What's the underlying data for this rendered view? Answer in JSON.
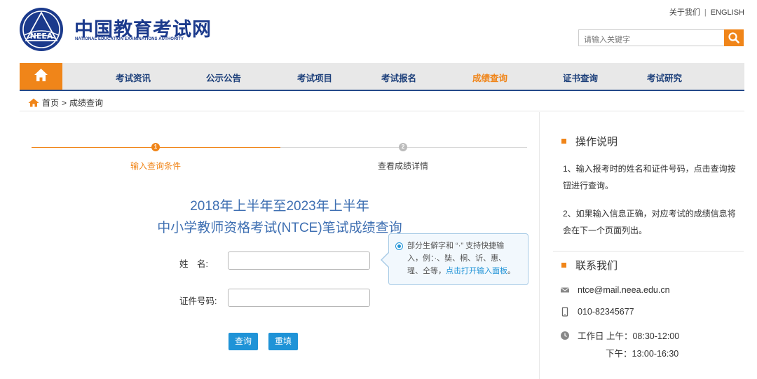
{
  "header": {
    "logo_cn": "中国教育考试网",
    "logo_en": "NATIONAL EDUCATION EXAMINATIONS AUTHORITY",
    "logo_emblem_text": "NEEA",
    "top_links": [
      "关于我们",
      "ENGLISH"
    ],
    "search_placeholder": "请输入关键字",
    "search_icon": "search-icon"
  },
  "nav": {
    "home_icon": "home-icon",
    "items": [
      "考试资讯",
      "公示公告",
      "考试项目",
      "考试报名",
      "成绩查询",
      "证书查询",
      "考试研究"
    ],
    "active": "成绩查询"
  },
  "breadcrumb": {
    "home": "首页",
    "separator": ">",
    "current": "成绩查询"
  },
  "steps": [
    {
      "number": "1",
      "label": "输入查询条件"
    },
    {
      "number": "2",
      "label": "查看成绩详情"
    }
  ],
  "query": {
    "title_line1": "2018年上半年至2023年上半年",
    "title_line2": "中小学教师资格考试(NTCE)笔试成绩查询",
    "name_label": "姓　名:",
    "id_label": "证件号码:",
    "name_value": "",
    "id_value": "",
    "submit": "查询",
    "reset": "重填"
  },
  "tooltip": {
    "line1": "部分生僻字和 “·” 支持快捷输",
    "line2": "入，例：·、奘、桐、䜣、惠、",
    "line3_prefix": "瑆、仝等，",
    "line3_link": "点击打开输入面板",
    "line3_suffix": "。"
  },
  "sidebar": {
    "instructions_title": "操作说明",
    "instructions": [
      "1、输入报考时的姓名和证件号码，点击查询按钮进行查询。",
      "2、如果输入信息正确，对应考试的成绩信息将会在下一个页面列出。"
    ],
    "contact_title": "联系我们",
    "email": "ntce@mail.neea.edu.cn",
    "phone": "010-82345677",
    "hours_line1": "工作日 上午：08:30-12:00",
    "hours_line2": "下午：13:00-16:30"
  },
  "colors": {
    "accent": "#f08519",
    "brand": "#1b3a8c",
    "title_blue": "#3e6fb2",
    "button_blue": "#1f93d7"
  }
}
